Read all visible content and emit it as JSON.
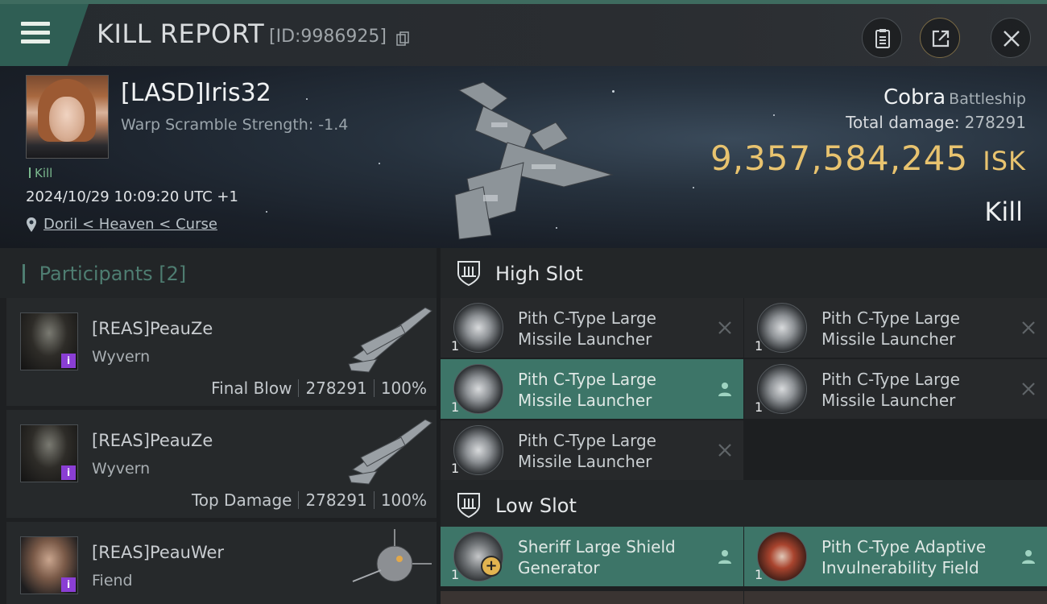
{
  "header": {
    "title": "KILL REPORT",
    "report_id": "[ID:9986925]"
  },
  "victim": {
    "name": "[LASD]Iris32",
    "warp_scramble": "Warp Scramble Strength: -1.4",
    "kill_tag": "Kill",
    "datetime": "2024/10/29 10:09:20 UTC +1",
    "location": "Doril < Heaven < Curse",
    "ship_name": "Cobra",
    "ship_class": "Battleship",
    "total_damage_label": "Total damage:",
    "total_damage_value": "278291",
    "isk_value": "9,357,584,245",
    "isk_unit": "ISK",
    "result": "Kill"
  },
  "participants": {
    "title": "Participants",
    "count": "[2]",
    "rows": [
      {
        "name": "[REAS]PeauZe",
        "ship": "Wyvern",
        "role": "Final Blow",
        "damage": "278291",
        "percent": "100%"
      },
      {
        "name": "[REAS]PeauZe",
        "ship": "Wyvern",
        "role": "Top Damage",
        "damage": "278291",
        "percent": "100%"
      },
      {
        "name": "[REAS]PeauWer",
        "ship": "Fiend",
        "role": "",
        "damage": "",
        "percent": ""
      }
    ]
  },
  "slots": {
    "high": {
      "title": "High Slot",
      "modules": [
        {
          "qty": "1",
          "line1": "Pith C-Type Large",
          "line2": "Missile Launcher",
          "state": "destroyed"
        },
        {
          "qty": "1",
          "line1": "Pith C-Type Large",
          "line2": "Missile Launcher",
          "state": "destroyed"
        },
        {
          "qty": "1",
          "line1": "Pith C-Type Large",
          "line2": "Missile Launcher",
          "state": "dropped"
        },
        {
          "qty": "1",
          "line1": "Pith C-Type Large",
          "line2": "Missile Launcher",
          "state": "destroyed"
        },
        {
          "qty": "1",
          "line1": "Pith C-Type Large",
          "line2": "Missile Launcher",
          "state": "destroyed"
        }
      ]
    },
    "low": {
      "title": "Low Slot",
      "modules": [
        {
          "qty": "1",
          "line1": "Sheriff Large Shield",
          "line2": "Generator",
          "state": "dropped"
        },
        {
          "qty": "1",
          "line1": "Pith C-Type Adaptive",
          "line2": "Invulnerability Field",
          "state": "dropped"
        }
      ]
    }
  },
  "colors": {
    "accent": "#3d7568",
    "isk": "#e8c36f",
    "kill_green": "#7bb98e"
  }
}
